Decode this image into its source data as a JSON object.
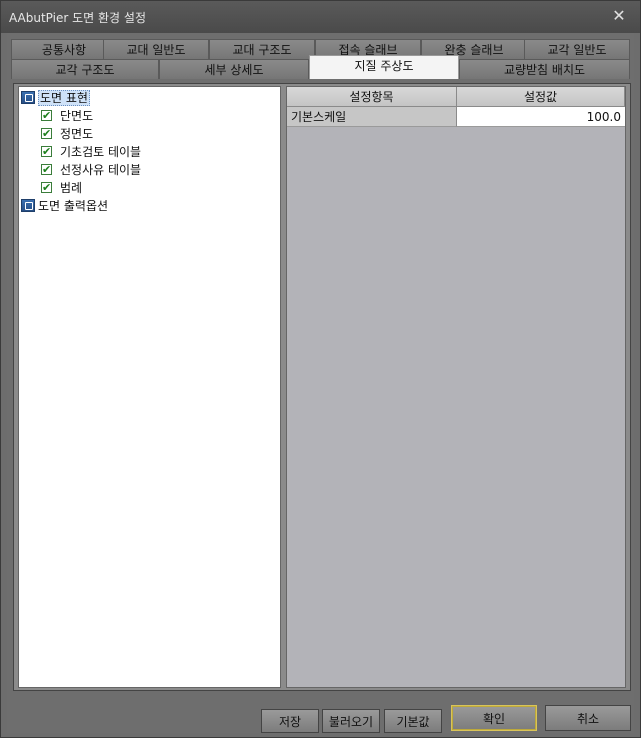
{
  "window": {
    "title": "AAbutPier 도면 환경 설정",
    "close_glyph": "✕"
  },
  "tabs_row1": [
    "공통사항",
    "교대 일반도",
    "교대 구조도",
    "접속 슬래브",
    "완충 슬래브",
    "교각 일반도"
  ],
  "tabs_row2": [
    "교각 구조도",
    "세부 상세도",
    "지질 주상도",
    "교량받침 배치도"
  ],
  "active_tab": "지질 주상도",
  "tree": {
    "root1": "도면 표현",
    "children": [
      "단면도",
      "정면도",
      "기초검토 테이블",
      "선정사유 테이블",
      "범례"
    ],
    "root2": "도면 출력옵션"
  },
  "grid": {
    "headers": [
      "설정항목",
      "설정값"
    ],
    "rows": [
      {
        "label": "기본스케일",
        "value": "100.0"
      }
    ]
  },
  "buttons": {
    "save": "저장",
    "load": "불러오기",
    "default": "기본값",
    "ok": "확인",
    "cancel": "취소"
  }
}
